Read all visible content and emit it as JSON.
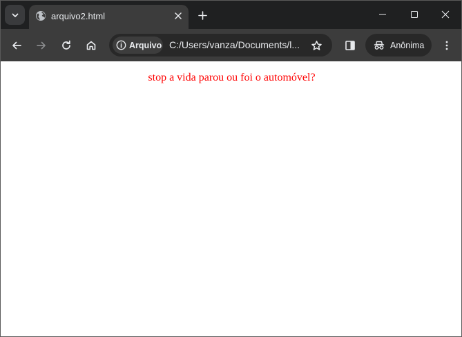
{
  "tab": {
    "title": "arquivo2.html"
  },
  "toolbar": {
    "site_chip_label": "Arquivo",
    "url": "C:/Users/vanza/Documents/l...",
    "incognito_label": "Anônima"
  },
  "icons": {
    "tab_search": "chevron-down-icon",
    "favicon": "globe-icon",
    "tab_close": "close-icon",
    "new_tab": "plus-icon",
    "minimize": "minimize-icon",
    "maximize": "maximize-icon",
    "close_window": "close-icon",
    "back": "arrow-left-icon",
    "forward": "arrow-right-icon",
    "reload": "reload-icon",
    "home": "home-icon",
    "info": "info-icon",
    "bookmark": "star-icon",
    "side_panel": "side-panel-icon",
    "incognito": "incognito-icon",
    "menu": "kebab-menu-icon"
  },
  "colors": {
    "tabstrip_bg": "#1f2021",
    "toolbar_bg": "#3c3c3c",
    "page_text": "#ff0000"
  },
  "page": {
    "text": "stop a vida parou ou foi o automóvel?"
  }
}
